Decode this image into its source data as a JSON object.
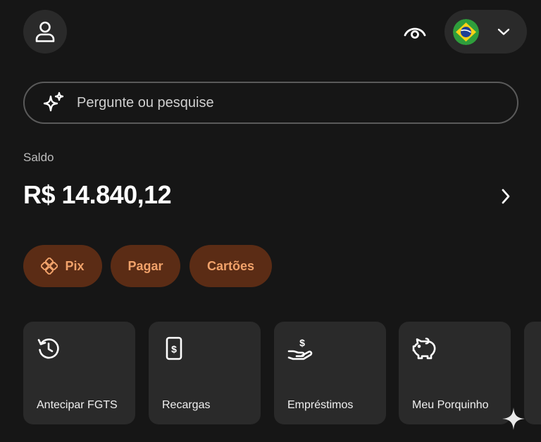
{
  "header": {
    "profile_icon": "user-icon",
    "visibility_icon": "eye-icon",
    "country_flag": "brazil-flag-icon",
    "country_chevron": "chevron-down-icon"
  },
  "search": {
    "placeholder": "Pergunte ou pesquise",
    "icon": "sparkle-icon"
  },
  "balance": {
    "label": "Saldo",
    "value": "R$ 14.840,12"
  },
  "quick_actions": [
    {
      "label": "Pix",
      "icon": "pix-icon"
    },
    {
      "label": "Pagar"
    },
    {
      "label": "Cartões"
    }
  ],
  "shortcuts": [
    {
      "label": "Antecipar FGTS",
      "icon": "history-icon"
    },
    {
      "label": "Recargas",
      "icon": "phone-recharge-icon"
    },
    {
      "label": "Empréstimos",
      "icon": "hand-coin-icon"
    },
    {
      "label": "Meu Porquinho",
      "icon": "piggy-bank-icon"
    }
  ],
  "colors": {
    "background": "#161616",
    "surface": "#2a2a2a",
    "pill_background": "#5b2c15",
    "pill_text": "#f1a26a",
    "text_primary": "#ffffff",
    "text_secondary": "#bdbdbd"
  }
}
